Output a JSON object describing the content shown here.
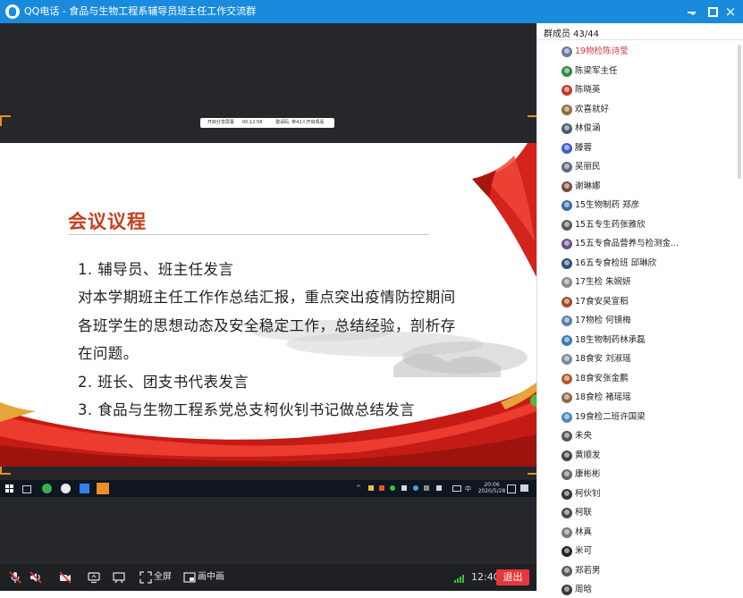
{
  "window": {
    "title": "QQ电话 - 食品与生物工程系辅导员班主任工作交流群",
    "accent": "#1a8bdc"
  },
  "share_bar": {
    "status": "开启分享屏幕",
    "timer": "00:12:58",
    "note": "邀请码, 参42人开启观看"
  },
  "slide": {
    "heading": "会议议程",
    "lines": [
      "1. 辅导员、班主任发言",
      "对本学期班主任工作作总结汇报，重点突出疫情防控期间",
      "各班学生的思想动态及安全稳定工作，总结经验，剖析存",
      "在问题。",
      "2. 班长、团支书代表发言",
      "3. 食品与生物工程系党总支柯伙钊书记做总结发言"
    ],
    "heading_color": "#c63e1c",
    "ribbon_color": "#d4231c"
  },
  "taskbar": {
    "ime": "中",
    "clock_time": "20:06",
    "clock_date": "2020/5/28"
  },
  "controls": {
    "fullscreen_label": "全屏",
    "pip_label": "画中画",
    "call_time": "12:40",
    "exit_label": "退出",
    "exit_color": "#e8373a"
  },
  "members": {
    "header": "群成员 43/44",
    "list": [
      {
        "name": "19物检陈诗莹",
        "color": "#6a7b9c"
      },
      {
        "name": "陈梁军主任",
        "color": "#2e8b3e"
      },
      {
        "name": "陈晓英",
        "color": "#c0392b"
      },
      {
        "name": "欢喜就好",
        "color": "#8a6d3b"
      },
      {
        "name": "林俊涵",
        "color": "#4a5a6a"
      },
      {
        "name": "滕蓉",
        "color": "#3b5bd9"
      },
      {
        "name": "吴丽民",
        "color": "#5f6b7a"
      },
      {
        "name": "谢琳娜",
        "color": "#7a4a3a"
      },
      {
        "name": "15生物制药  郑彦",
        "color": "#3a6ea5"
      },
      {
        "name": "15五专生药张雅欣",
        "color": "#5a5a5a"
      },
      {
        "name": "15五专食品营养与检测金...",
        "color": "#6b4f8a"
      },
      {
        "name": "16五专食检班  邱琳欣",
        "color": "#2a4f7a"
      },
      {
        "name": "17生检 朱婉妍",
        "color": "#8a8a8a"
      },
      {
        "name": "17食安吴宣稆",
        "color": "#a04a2a"
      },
      {
        "name": "17物检 何镜梅",
        "color": "#5b7fa8"
      },
      {
        "name": "18生物制药林承磊",
        "color": "#3a7ab0"
      },
      {
        "name": "18食安   刘淑瑶",
        "color": "#7a8a9a"
      },
      {
        "name": "18食安张金鹏",
        "color": "#b05a2a"
      },
      {
        "name": "18食检  褚瑶瑶",
        "color": "#8a6a4a"
      },
      {
        "name": "19食检二班许国梁",
        "color": "#4a8ac0"
      },
      {
        "name": "未央",
        "color": "#555555"
      },
      {
        "name": "黄顺发",
        "color": "#444444"
      },
      {
        "name": "康彬彬",
        "color": "#666666"
      },
      {
        "name": "柯伙钊",
        "color": "#333333"
      },
      {
        "name": "柯联",
        "color": "#4a4a4a"
      },
      {
        "name": "林真",
        "color": "#777777"
      },
      {
        "name": "米可",
        "color": "#222222"
      },
      {
        "name": "郑若男",
        "color": "#5a5a5a"
      },
      {
        "name": "周晗",
        "color": "#3a3a3a"
      }
    ]
  }
}
